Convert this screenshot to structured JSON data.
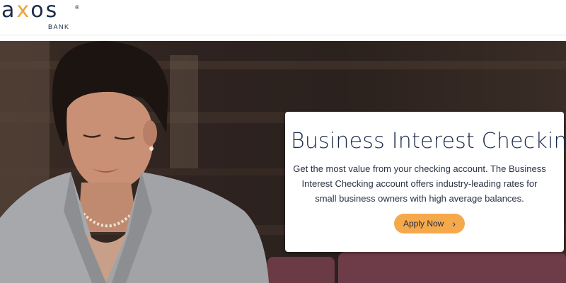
{
  "header": {
    "logo_text": "axos",
    "logo_sub": "BANK",
    "logo_registered": "®"
  },
  "card": {
    "title": "Business Interest Checking",
    "body": "Get the most value from your checking account. The Business Interest Checking account offers industry-leading rates for small business owners with high average balances.",
    "cta_label": "Apply Now",
    "cta_icon": "chevron-right-icon"
  },
  "colors": {
    "brand_navy": "#1a2a4a",
    "brand_orange": "#f0a23a",
    "button_orange": "#f6a94a"
  }
}
